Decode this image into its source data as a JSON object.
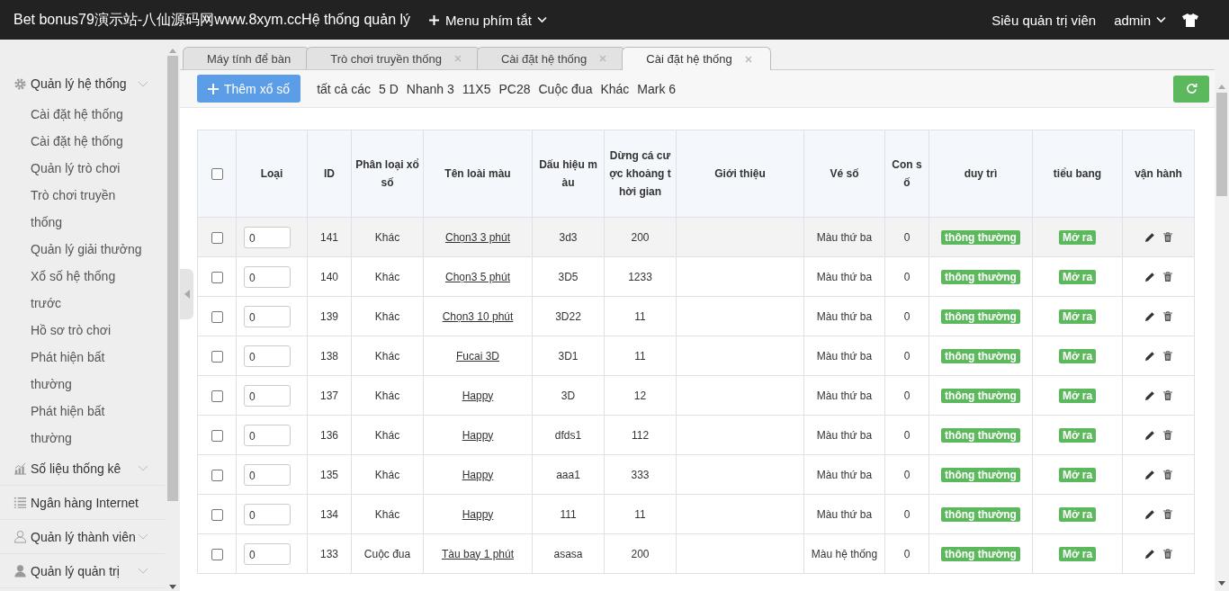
{
  "header": {
    "title": "Bet bonus79演示站-八仙源码网www.8xym.ccHệ thống quản lý",
    "menu": "Menu phím tắt",
    "role": "Siêu quản trị viên",
    "user": "admin"
  },
  "sidebar": {
    "groups": [
      {
        "label": "Quản lý hệ thống",
        "kind": "gear",
        "collapsible": true,
        "children": [
          "Cài đặt hệ thống",
          "Cài đặt hệ thống",
          "Quản lý trò chơi",
          "Trò chơi truyền thống",
          "Quản lý giải thưởng",
          "Xổ số hệ thống trước",
          "Hồ sơ trò chơi",
          "Phát hiện bất thường",
          "Phát hiện bất thường"
        ]
      },
      {
        "label": "Số liệu thống kê",
        "kind": "chart",
        "collapsible": true
      },
      {
        "label": "Ngân hàng Internet",
        "kind": "list",
        "collapsible": false
      },
      {
        "label": "Quản lý thành viên",
        "kind": "user-outline",
        "collapsible": true
      },
      {
        "label": "Quản lý quản trị",
        "kind": "user",
        "collapsible": true
      }
    ]
  },
  "tabs": [
    {
      "label": "Máy tính để bàn",
      "closable": false,
      "selected": false
    },
    {
      "label": "Trò chơi truyền thống",
      "closable": true,
      "selected": false
    },
    {
      "label": "Cài đặt hệ thống",
      "closable": true,
      "selected": false
    },
    {
      "label": "Cài đặt hệ thống",
      "closable": true,
      "selected": true
    }
  ],
  "toolbar": {
    "add_button": "Thêm xổ số",
    "filters": [
      "tất cả các",
      "5 D",
      "Nhanh 3",
      "11X5",
      "PC28",
      "Cuộc đua",
      "Khác",
      "Mark 6"
    ]
  },
  "table": {
    "all_checked": false,
    "columns": [
      "Loại",
      "ID",
      "Phân loại xổ số",
      "Tên loài màu",
      "Dấu hiệu màu",
      "Dừng cá cược khoảng thời gian",
      "Giới thiệu",
      "Vé số",
      "Con số",
      "duy trì",
      "tiểu bang",
      "vận hành"
    ],
    "rows": [
      {
        "checked": false,
        "hovered": true,
        "order": "0",
        "id": "141",
        "category": "Khác",
        "name": "Chọn3 3 phút",
        "code": "3d3",
        "stop_time": "200",
        "ticket": "Màu thứ ba",
        "number": "0",
        "maintain": "thông thường",
        "status": "Mở ra"
      },
      {
        "checked": false,
        "hovered": false,
        "order": "0",
        "id": "140",
        "category": "Khác",
        "name": "Chọn3 5 phút",
        "code": "3D5",
        "stop_time": "1233",
        "ticket": "Màu thứ ba",
        "number": "0",
        "maintain": "thông thường",
        "status": "Mở ra"
      },
      {
        "checked": false,
        "hovered": false,
        "order": "0",
        "id": "139",
        "category": "Khác",
        "name": "Chọn3 10 phút",
        "code": "3D22",
        "stop_time": "11",
        "ticket": "Màu thứ ba",
        "number": "0",
        "maintain": "thông thường",
        "status": "Mở ra"
      },
      {
        "checked": false,
        "hovered": false,
        "order": "0",
        "id": "138",
        "category": "Khác",
        "name": "Fucai 3D",
        "code": "3D1",
        "stop_time": "11",
        "ticket": "Màu thứ ba",
        "number": "0",
        "maintain": "thông thường",
        "status": "Mở ra"
      },
      {
        "checked": false,
        "hovered": false,
        "order": "0",
        "id": "137",
        "category": "Khác",
        "name": "Happy",
        "code": "3D",
        "stop_time": "12",
        "ticket": "Màu thứ ba",
        "number": "0",
        "maintain": "thông thường",
        "status": "Mở ra"
      },
      {
        "checked": false,
        "hovered": false,
        "order": "0",
        "id": "136",
        "category": "Khác",
        "name": "Happy",
        "code": "dfds1",
        "stop_time": "112",
        "ticket": "Màu thứ ba",
        "number": "0",
        "maintain": "thông thường",
        "status": "Mở ra"
      },
      {
        "checked": false,
        "hovered": false,
        "order": "0",
        "id": "135",
        "category": "Khác",
        "name": "Happy",
        "code": "aaa1",
        "stop_time": "333",
        "ticket": "Màu thứ ba",
        "number": "0",
        "maintain": "thông thường",
        "status": "Mở ra"
      },
      {
        "checked": false,
        "hovered": false,
        "order": "0",
        "id": "134",
        "category": "Khác",
        "name": "Happy",
        "code": "111",
        "stop_time": "11",
        "ticket": "Màu thứ ba",
        "number": "0",
        "maintain": "thông thường",
        "status": "Mở ra"
      },
      {
        "checked": false,
        "hovered": false,
        "order": "0",
        "id": "133",
        "category": "Cuộc đua",
        "name": "Tàu bay 1 phút",
        "code": "asasa",
        "stop_time": "200",
        "ticket": "Màu hệ thống",
        "number": "0",
        "maintain": "thông thường",
        "status": "Mở ra"
      }
    ]
  }
}
